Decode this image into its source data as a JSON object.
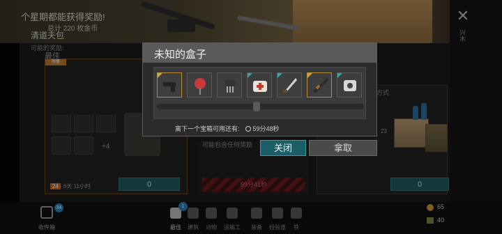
{
  "banner": {
    "line1": "个星期都能获得奖励!",
    "line2": "总计 220 枚金币"
  },
  "side": {
    "close_glyph": "✕",
    "vertical_label": "兴木"
  },
  "sections": {
    "best": "最佳"
  },
  "pack": {
    "tag": "限量",
    "title": "清道夫包",
    "possible_rewards": "可能的奖励:",
    "more": "+4",
    "level": "24",
    "time_left": "6天 11小时",
    "price": "0"
  },
  "middle": {
    "may_contain": "可能包含任何奖励",
    "locked_timer": "59分41秒"
  },
  "right_panel": {
    "cut_text": "方式",
    "count": "23",
    "price": "0"
  },
  "dialog": {
    "title": "未知的盒子",
    "refresh_prefix": "离下一个宝箱可用还有:",
    "refresh_time": "59分48秒",
    "close_label": "关闭",
    "take_label": "拿取",
    "items": [
      {
        "icon": "pistol-icon",
        "rarity": "gold",
        "selected": true
      },
      {
        "icon": "stop-sign-icon",
        "rarity": "none",
        "selected": false
      },
      {
        "icon": "component-icon",
        "rarity": "none",
        "selected": false
      },
      {
        "icon": "medkit-icon",
        "rarity": "teal",
        "selected": false
      },
      {
        "icon": "machete-icon",
        "rarity": "teal",
        "selected": false
      },
      {
        "icon": "shotgun-icon",
        "rarity": "gold",
        "selected": false
      },
      {
        "icon": "robot-part-icon",
        "rarity": "teal",
        "selected": false
      }
    ]
  },
  "nav": {
    "inbox_label": "收件箱",
    "inbox_badge": "34",
    "best_badge": "1",
    "items": [
      {
        "label": "最佳",
        "active": true
      },
      {
        "label": "建筑",
        "active": false
      },
      {
        "label": "动物",
        "active": false
      },
      {
        "label": "运输工具",
        "active": false
      },
      {
        "label": "装备",
        "active": false
      },
      {
        "label": "经验值",
        "active": false
      },
      {
        "label": "铁",
        "active": false
      }
    ]
  },
  "currency": {
    "coins": "65",
    "resource": "40"
  }
}
